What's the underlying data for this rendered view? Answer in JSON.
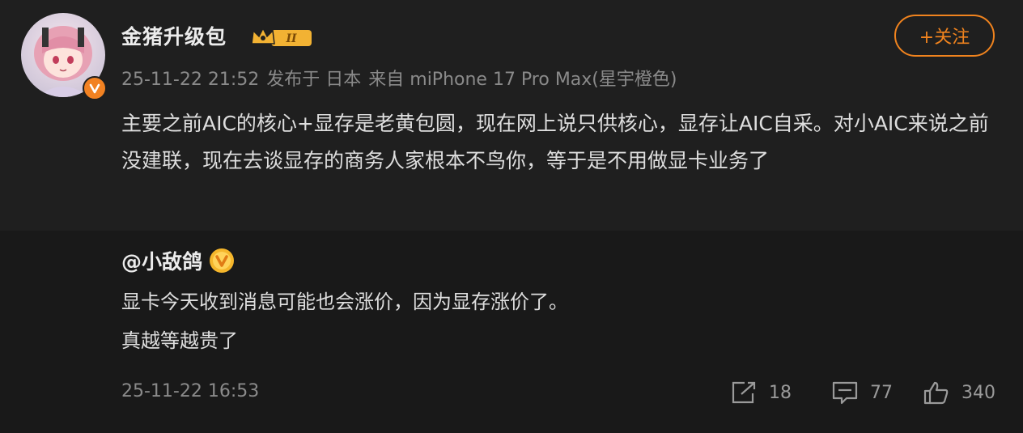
{
  "post": {
    "username": "金猪升级包",
    "level_badge": "II",
    "follow_label": "+关注",
    "meta": {
      "time": "25-11-22 21:52",
      "location": "发布于 日本",
      "source": "来自 miPhone 17 Pro Max(星宇橙色)"
    },
    "text": "主要之前AIC的核心+显存是老黄包圆，现在网上说只供核心，显存让AIC自采。对小AIC来说之前没建联，现在去谈显存的商务人家根本不鸟你，等于是不用做显卡业务了"
  },
  "quoted": {
    "mention": "@小敌鸽",
    "line1": "显卡今天收到消息可能也会涨价，因为显存涨价了。",
    "line2": "真越等越贵了",
    "time": "25-11-22 16:53",
    "actions": {
      "share_count": "18",
      "comment_count": "77",
      "like_count": "340"
    }
  },
  "colors": {
    "accent": "#f0831e",
    "background": "#1f1f1f",
    "quoted_background": "#191919",
    "muted_text": "#8a8a8a"
  },
  "icons": [
    "verified-v-icon",
    "crown-level-icon",
    "gold-medal-icon",
    "share-icon",
    "comment-icon",
    "like-icon"
  ]
}
